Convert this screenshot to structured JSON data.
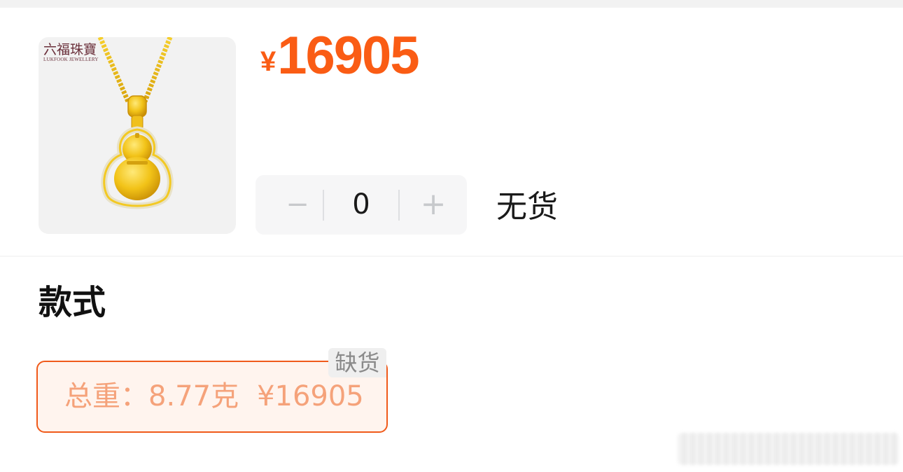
{
  "product": {
    "brand_cn": "六福珠寶",
    "brand_en": "LUKFOOK JEWELLERY",
    "image_icon": "gold-gourd-pendant-icon"
  },
  "price": {
    "currency": "¥",
    "amount": "16905"
  },
  "quantity": {
    "minus_label": "−",
    "value": "0",
    "plus_label": "+"
  },
  "stock_status": "无货",
  "spec": {
    "title": "款式",
    "options": [
      {
        "weight_label": "总重：",
        "weight_value": "8.77克",
        "price": "¥16905",
        "badge": "缺货"
      }
    ]
  },
  "colors": {
    "accent": "#fa5c14",
    "option_border": "#f05a1a",
    "option_bg": "#fff4ee",
    "option_text": "#f5a27a"
  }
}
